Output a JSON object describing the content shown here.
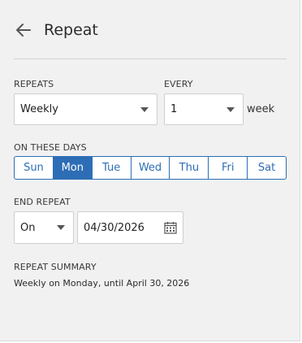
{
  "header": {
    "title": "Repeat",
    "back_icon": "arrow-left-icon"
  },
  "repeats": {
    "label": "REPEATS",
    "value": "Weekly"
  },
  "every": {
    "label": "EVERY",
    "value": "1",
    "unit": "week"
  },
  "days": {
    "label": "ON THESE DAYS",
    "items": [
      "Sun",
      "Mon",
      "Tue",
      "Wed",
      "Thu",
      "Fri",
      "Sat"
    ],
    "selected": "Mon"
  },
  "end_repeat": {
    "label": "END REPEAT",
    "mode": "On",
    "date": "04/30/2026",
    "calendar_icon": "calendar-icon"
  },
  "summary": {
    "label": "REPEAT SUMMARY",
    "text": "Weekly on Monday, until April 30, 2026"
  },
  "colors": {
    "accent": "#2d6db5",
    "panel_bg": "#f1f1f1"
  }
}
